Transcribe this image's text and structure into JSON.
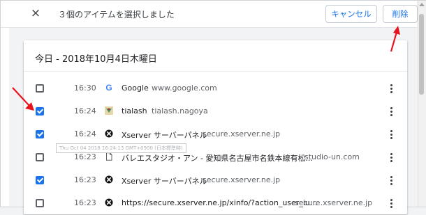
{
  "topbar": {
    "close_icon": "×",
    "selection_text": "３個のアイテムを選択しました",
    "cancel_label": "キャンセル",
    "delete_label": "削除"
  },
  "history": {
    "date_heading": "今日 - 2018年10月4日木曜日",
    "rows": [
      {
        "checked": false,
        "time": "16:30",
        "favicon": "google-favicon",
        "title": "Google",
        "domain": "www.google.com"
      },
      {
        "checked": true,
        "time": "16:24",
        "favicon": "tialash-favicon",
        "title": "tialash",
        "domain": "tialash.nagoya"
      },
      {
        "checked": true,
        "time": "16:24",
        "favicon": "xserver-favicon",
        "title": "Xserver サーバーパネル",
        "domain": "secure.xserver.ne.jp"
      },
      {
        "checked": false,
        "time": "16:23",
        "favicon": "page-favicon",
        "title": "バレエスタジオ・アン - 愛知県名古屋市名鉄本線有松...",
        "domain": "studio-un.com"
      },
      {
        "checked": true,
        "time": "16:23",
        "favicon": "xserver-favicon",
        "title": "Xserver サーバーパネル",
        "domain": "secure.xserver.ne.jp"
      },
      {
        "checked": false,
        "time": "16:23",
        "favicon": "xserver-favicon",
        "title": "https://secure.xserver.ne.jp/xinfo/?action_user_iu...",
        "domain": "secure.xserver.ne.jp"
      }
    ],
    "tooltip": "Thu Oct 04 2018 16:24:13 GMT+0900 (日本標準時)"
  },
  "colors": {
    "accent": "#1a73e8",
    "annotation_arrow": "#e8141d"
  }
}
